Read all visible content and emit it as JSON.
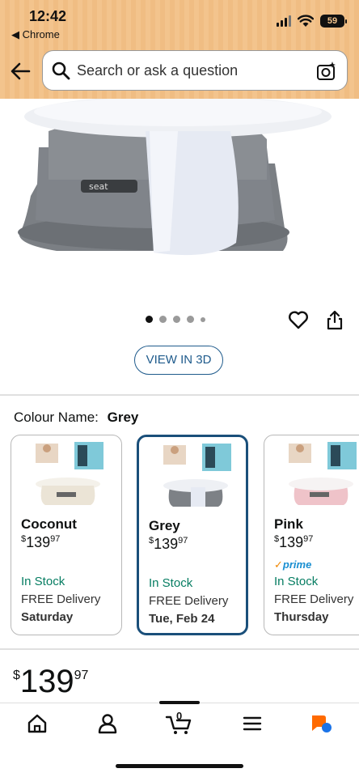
{
  "status_bar": {
    "time": "12:42",
    "back_app": "◀ Chrome",
    "battery": "59"
  },
  "search": {
    "placeholder": "Search or ask a question"
  },
  "gallery": {
    "image_count": 5,
    "active_index": 0
  },
  "view_3d_label": "VIEW IN 3D",
  "colour": {
    "label": "Colour Name:",
    "selected": "Grey"
  },
  "variants": [
    {
      "name": "Coconut",
      "price_symbol": "$",
      "price_whole": "139",
      "price_fraction": "97",
      "prime": "",
      "stock": "In Stock",
      "delivery": "FREE Delivery",
      "delivery_day": "Saturday"
    },
    {
      "name": "Grey",
      "price_symbol": "$",
      "price_whole": "139",
      "price_fraction": "97",
      "prime": "",
      "stock": "In Stock",
      "delivery": "FREE Delivery",
      "delivery_day": "Tue, Feb 24"
    },
    {
      "name": "Pink",
      "price_symbol": "$",
      "price_whole": "139",
      "price_fraction": "97",
      "prime": "prime",
      "stock": "In Stock",
      "delivery": "FREE Delivery",
      "delivery_day": "Thursday"
    }
  ],
  "price": {
    "symbol": "$",
    "whole": "139",
    "fraction": "97"
  },
  "bottom_nav": {
    "cart_count": "0",
    "items": [
      "home-icon",
      "account-icon",
      "cart-icon",
      "menu-icon",
      "assistant-icon"
    ]
  },
  "colors": {
    "header_bg": "#f3c48d",
    "link_blue": "#1f5b8c",
    "stock_green": "#067d62",
    "selected_border": "#1a4f7a"
  }
}
